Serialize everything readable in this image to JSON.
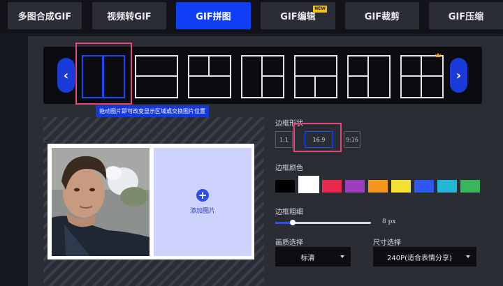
{
  "tabs": [
    {
      "label": "多图合成GIF",
      "active": false
    },
    {
      "label": "视频转GIF",
      "active": false
    },
    {
      "label": "GIF拼图",
      "active": true
    },
    {
      "label": "GIF编辑",
      "active": false,
      "badge": "NEW"
    },
    {
      "label": "GIF裁剪",
      "active": false
    },
    {
      "label": "GIF压缩",
      "active": false
    }
  ],
  "layouts": {
    "prev_icon": "chevron-left-icon",
    "next_icon": "chevron-right-icon",
    "prev_glyph": "‹",
    "next_glyph": "›",
    "selected_index": 0,
    "premium_icon": "crown-icon",
    "tooltip": "拖动图片即可改变显示区域或交换图片位置"
  },
  "canvas": {
    "add_label": "添加图片",
    "add_icon": "plus-icon",
    "add_glyph": "+"
  },
  "settings": {
    "shape_label": "边框形状",
    "ratios": [
      {
        "label": "1:1",
        "selected": false
      },
      {
        "label": "16:9",
        "selected": true
      },
      {
        "label": "9:16",
        "selected": false
      }
    ],
    "color_label": "边框颜色",
    "colors": [
      "#000000",
      "#ffffff",
      "#e9294a",
      "#9b3fc0",
      "#f5951c",
      "#f5e131",
      "#2e58f0",
      "#20b8d6",
      "#3ab55c"
    ],
    "selected_color": "#ffffff",
    "thickness_label": "边框粗细",
    "thickness_value": "8 px",
    "quality_label": "画质选择",
    "quality_value": "标清",
    "size_label": "尺寸选择",
    "size_value": "240P(适合表情分享)"
  }
}
